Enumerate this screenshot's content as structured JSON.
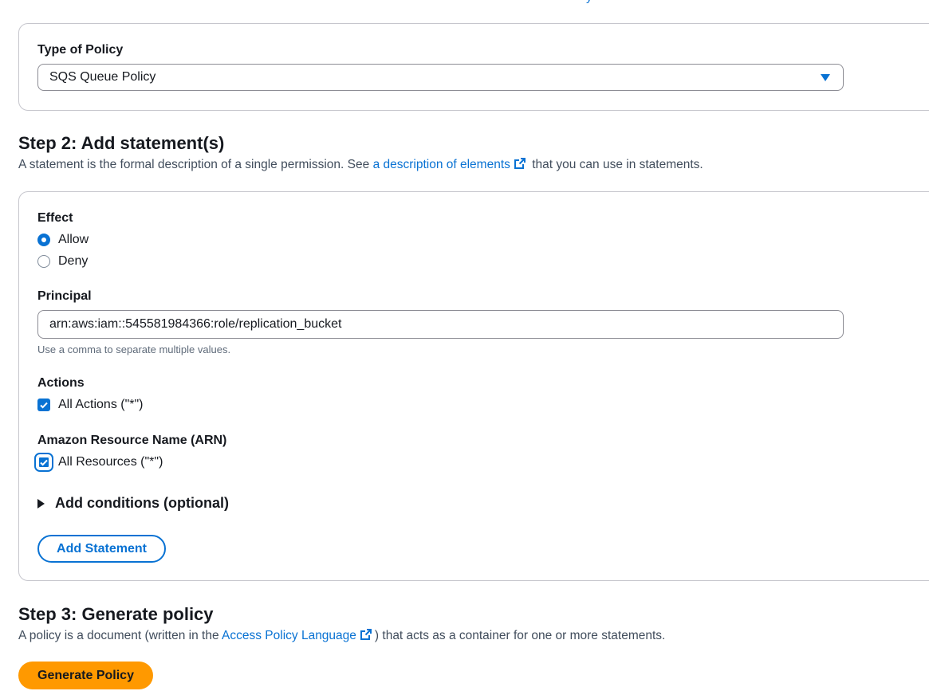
{
  "top_partial": {
    "link1": "y",
    "link2": "y",
    "link3": "y"
  },
  "type_section": {
    "label": "Type of Policy",
    "selected": "SQS Queue Policy"
  },
  "step2": {
    "heading": "Step 2: Add statement(s)",
    "desc_before": "A statement is the formal description of a single permission. See ",
    "desc_link": "a description of elements",
    "desc_after": " that you can use in statements.",
    "effect_label": "Effect",
    "effect_options": [
      "Allow",
      "Deny"
    ],
    "effect_selected": "Allow",
    "principal_label": "Principal",
    "principal_value": "arn:aws:iam::545581984366:role/replication_bucket",
    "principal_hint": "Use a comma to separate multiple values.",
    "actions_label": "Actions",
    "actions_checkbox": "All Actions (\"*\")",
    "arn_label": "Amazon Resource Name (ARN)",
    "arn_checkbox": "All Resources (\"*\")",
    "conditions_label": "Add conditions (optional)",
    "add_button": "Add Statement"
  },
  "step3": {
    "heading": "Step 3: Generate policy",
    "desc_before": "A policy is a document (written in the ",
    "desc_link": "Access Policy Language",
    "desc_after": ") that acts as a container for one or more statements.",
    "generate_button": "Generate Policy"
  },
  "colors": {
    "link": "#0972d3",
    "primary": "#ff9900",
    "text": "#16191f"
  }
}
